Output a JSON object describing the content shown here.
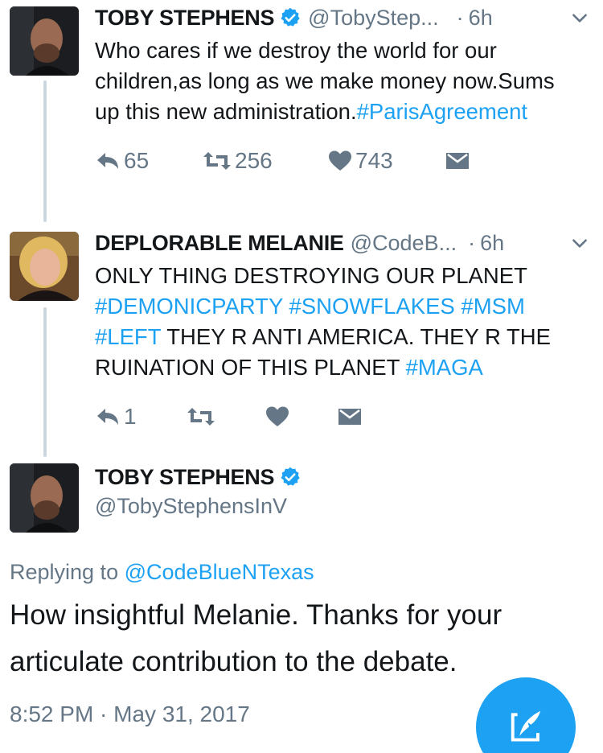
{
  "tweets": [
    {
      "name": "TOBY STEPHENS",
      "handle": "@TobyStep...",
      "dot": "·",
      "time": "6h",
      "text_parts": [
        "Who cares if we destroy the world for our children,as long as we make money now.Sums up this new administration."
      ],
      "hashtags": [
        "#ParisAgreement"
      ],
      "replies": "65",
      "retweets": "256",
      "likes": "743"
    },
    {
      "name": "DEPLORABLE MELANIE",
      "handle": "@CodeB...",
      "dot": "·",
      "time": "6h",
      "text_line1": "ONLY THING DESTROYING OUR PLANET",
      "hashtag1": "#DEMONICPARTY",
      "hashtag2": "#SNOWFLAKES",
      "hashtag3": "#MSM",
      "hashtag4": "#LEFT",
      "text_mid": "THEY R ANTI AMERICA. THEY R THE RUINATION OF THIS PLANET",
      "hashtag5": "#MAGA",
      "replies": "1"
    }
  ],
  "main": {
    "name": "TOBY STEPHENS",
    "handle": "@TobyStephensInV",
    "replying_prefix": "Replying to",
    "replying_mention": "@CodeBlueNTexas",
    "text": "How insightful Melanie. Thanks for your articulate contribution to the debate.",
    "timestamp": "8:52 PM · May 31, 2017"
  },
  "colors": {
    "accent": "#1da1f2",
    "secondary_text": "#657786",
    "thread_line": "#ccd6dd"
  },
  "icons": [
    "verified-badge-icon",
    "chevron-down-icon",
    "reply-icon",
    "retweet-icon",
    "like-icon",
    "direct-message-icon",
    "compose-tweet-icon"
  ]
}
